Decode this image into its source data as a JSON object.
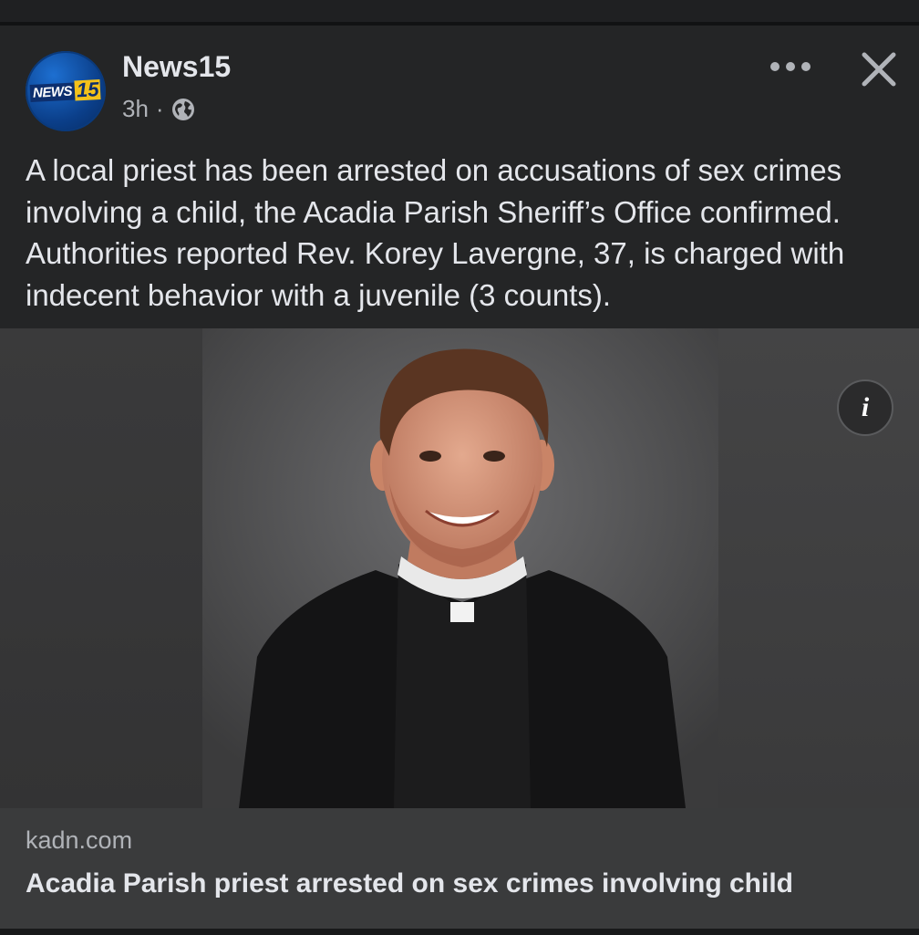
{
  "post": {
    "page_name": "News15",
    "avatar_logo_word": "NEWS",
    "avatar_logo_number": "15",
    "time": "3h",
    "separator": "·",
    "privacy_icon": "globe-icon",
    "more_icon": "more-dots-icon",
    "close_icon": "close-icon",
    "caption": "A local priest has been arrested on accusations of sex crimes involving a child, the Acadia Parish Sheriff’s Office confirmed. Authorities reported Rev. Korey Lavergne, 37, is charged with indecent behavior with a juvenile (3 counts).",
    "info_label": "i"
  },
  "link_preview": {
    "domain": "kadn.com",
    "headline": "Acadia Parish priest arrested on sex crimes involving child"
  },
  "colors": {
    "background": "#18191a",
    "card": "#242526",
    "link_box": "#3a3b3c",
    "primary_text": "#e4e6eb",
    "secondary_text": "#b0b3b8"
  }
}
